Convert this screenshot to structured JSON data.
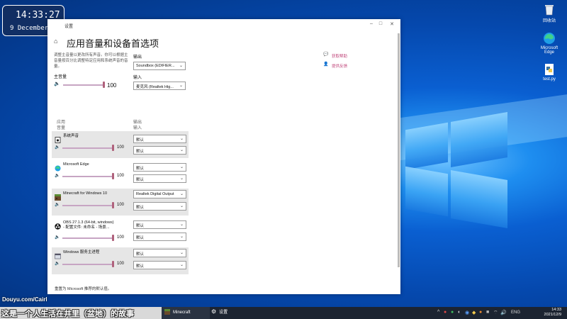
{
  "overlay": {
    "clock_time": "14:33:27",
    "clock_date": "9 December",
    "watermark": "Douyu.com/Cairl",
    "banner": "这是一个人生活在井里（盆地）的故事"
  },
  "desktop": {
    "icons": [
      {
        "label": "回收站",
        "icon": "recycle-bin-icon"
      },
      {
        "label": "Microsoft Edge",
        "icon": "edge-icon"
      },
      {
        "label": "test.py",
        "icon": "python-file-icon"
      }
    ]
  },
  "window": {
    "title": "设置",
    "minimize": "–",
    "maximize": "□",
    "close": "✕",
    "page_title": "应用音量和设备首选项",
    "description": "调整主音量以更改所有声音。你可以根据主音量按百分比调整特定应用和系统声音的音量。",
    "master_label": "主音量",
    "master_value": "100",
    "output_label": "输出",
    "output_device": "Soundbox (EDIFIER...",
    "input_label": "输入",
    "input_device": "麦克风 (Realtek Hig...",
    "help_links": [
      "获取帮助",
      "提供反馈"
    ],
    "col_app": "应用",
    "col_volume": "音量",
    "col_output": "输出",
    "col_input": "输入",
    "apps": [
      {
        "name": "系统声音",
        "volume": "100",
        "output": "默认",
        "input": "默认"
      },
      {
        "name": "Microsoft Edge",
        "volume": "100",
        "output": "默认",
        "input": "默认"
      },
      {
        "name": "Minecraft for Windows 10",
        "volume": "100",
        "output": "Realtek Digital Output",
        "input": "默认"
      },
      {
        "name": "OBS 27.1.3 (64-bit, windows)",
        "subname": "- 配置文件: 未命名 - 场景...",
        "volume": "100",
        "output": "默认",
        "input": "默认"
      },
      {
        "name": "Windows 服务主进程",
        "volume": "100",
        "output": "默认",
        "input": "默认"
      }
    ],
    "reset_text": "重置为 Microsoft 推荐的默认值。"
  },
  "taskbar": {
    "apps": [
      {
        "label": "Minecraft",
        "icon": "minecraft-icon"
      },
      {
        "label": "设置",
        "icon": "gear-icon"
      }
    ],
    "language": "ENG",
    "time": "14:33",
    "date": "2021/12/9"
  },
  "colors": {
    "accent": "#b0627c",
    "link": "#c0467a",
    "taskbar": "#1c2431"
  }
}
